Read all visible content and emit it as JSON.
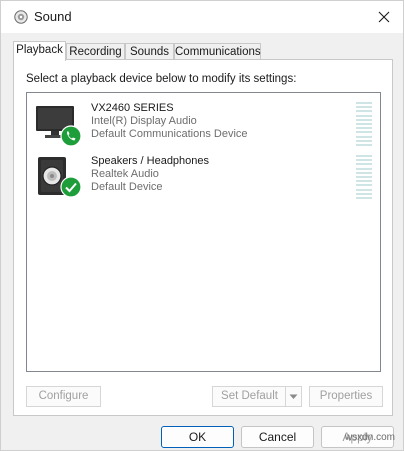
{
  "window": {
    "title": "Sound"
  },
  "tabs": [
    {
      "label": "Playback",
      "active": true
    },
    {
      "label": "Recording",
      "active": false
    },
    {
      "label": "Sounds",
      "active": false
    },
    {
      "label": "Communications",
      "active": false
    }
  ],
  "playback": {
    "instructions": "Select a playback device below to modify its settings:",
    "devices": [
      {
        "name": "VX2460 SERIES",
        "driver": "Intel(R) Display Audio",
        "status": "Default Communications Device",
        "icon": "monitor-icon",
        "badge": "phone-badge-icon"
      },
      {
        "name": "Speakers / Headphones",
        "driver": "Realtek Audio",
        "status": "Default Device",
        "icon": "speaker-icon",
        "badge": "checkmark-badge-icon"
      }
    ],
    "buttons": {
      "configure": "Configure",
      "set_default": "Set Default",
      "properties": "Properties"
    }
  },
  "footer": {
    "ok": "OK",
    "cancel": "Cancel",
    "apply": "Apply"
  },
  "watermark": "wsxdn.com",
  "colors": {
    "accent": "#005fb8",
    "badge_green": "#1e9e3a",
    "meter": "#cfe4e4"
  }
}
